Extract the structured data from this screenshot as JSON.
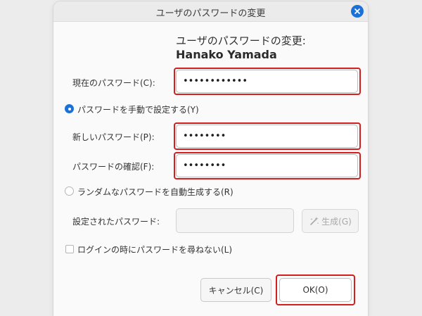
{
  "window": {
    "title": "ユーザのパスワードの変更",
    "close_icon": "close-icon"
  },
  "header": {
    "line1": "ユーザのパスワードの変更:",
    "user_name": "Hanako Yamada"
  },
  "form": {
    "current_password": {
      "label": "現在のパスワード(C):",
      "value": "••••••••••••"
    },
    "manual_option": {
      "label": "パスワードを手動で設定する(Y)",
      "selected": true
    },
    "new_password": {
      "label": "新しいパスワード(P):",
      "value": "••••••••"
    },
    "confirm_password": {
      "label": "パスワードの確認(F):",
      "value": "••••••••"
    },
    "auto_option": {
      "label": "ランダムなパスワードを自動生成する(R)",
      "selected": false
    },
    "generated_password": {
      "label": "設定されたパスワード:",
      "value": ""
    },
    "generate_button": {
      "label": "生成(G)",
      "icon": "generate-icon"
    },
    "login_without_password": {
      "label": "ログインの時にパスワードを尋ねない(L)",
      "checked": false
    }
  },
  "buttons": {
    "cancel": "キャンセル(C)",
    "ok": "OK(O)"
  },
  "colors": {
    "accent": "#1c71d8",
    "highlight": "#d21f1f"
  }
}
